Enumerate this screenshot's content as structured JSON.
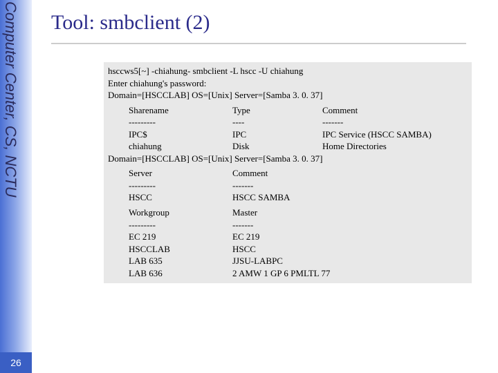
{
  "sidebar": {
    "label": "Computer Center, CS, NCTU"
  },
  "page_number": "26",
  "title": "Tool: smbclient (2)",
  "terminal": {
    "lines": [
      "hsccws5[~] -chiahung- smbclient -L hscc -U chiahung",
      "Enter chiahung's password:",
      "Domain=[HSCCLAB] OS=[Unix] Server=[Samba 3. 0. 37]"
    ],
    "share_table": {
      "headers": [
        "Sharename",
        "Type",
        "Comment"
      ],
      "divider": [
        "---------",
        "----",
        "-------"
      ],
      "rows": [
        [
          "IPC$",
          "IPC",
          "IPC Service (HSCC SAMBA)"
        ],
        [
          "chiahung",
          "Disk",
          "Home Directories"
        ]
      ],
      "footer": "Domain=[HSCCLAB] OS=[Unix] Server=[Samba 3. 0. 37]"
    },
    "server_table": {
      "headers": [
        "Server",
        "Comment"
      ],
      "divider": [
        "---------",
        "-------"
      ],
      "rows": [
        [
          "HSCC",
          "HSCC SAMBA"
        ]
      ]
    },
    "workgroup_table": {
      "headers": [
        "Workgroup",
        "Master"
      ],
      "divider": [
        "---------",
        "-------"
      ],
      "rows": [
        [
          "EC 219",
          "EC 219"
        ],
        [
          "HSCCLAB",
          "HSCC"
        ],
        [
          "LAB 635",
          "JJSU-LABPC"
        ],
        [
          "LAB 636",
          "2 AMW 1 GP 6 PMLTL 77"
        ]
      ]
    }
  }
}
